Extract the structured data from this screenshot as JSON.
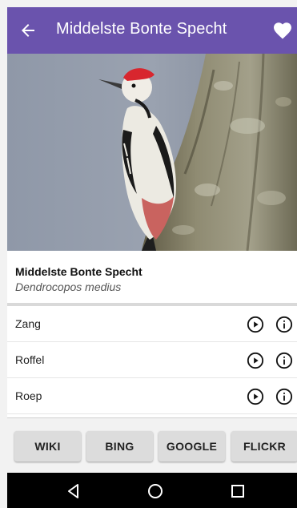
{
  "appbar": {
    "title": "Middelste Bonte Specht",
    "back_icon": "arrow-back-icon",
    "favorite_icon": "heart-icon",
    "color": "#6a53ad"
  },
  "photo": {
    "subject": "woodpecker on tree trunk"
  },
  "species": {
    "name": "Middelste Bonte Specht",
    "latin": "Dendrocopos medius"
  },
  "sounds": [
    {
      "label": "Zang",
      "play_icon": "play-circle-icon",
      "info_icon": "info-circle-icon"
    },
    {
      "label": "Roffel",
      "play_icon": "play-circle-icon",
      "info_icon": "info-circle-icon"
    },
    {
      "label": "Roep",
      "play_icon": "play-circle-icon",
      "info_icon": "info-circle-icon"
    }
  ],
  "links": {
    "wiki": "WIKI",
    "bing": "BING",
    "google": "GOOGLE",
    "flickr": "FLICKR"
  },
  "navbar": {
    "back_icon": "triangle-back-icon",
    "home_icon": "circle-home-icon",
    "recents_icon": "square-recents-icon"
  }
}
